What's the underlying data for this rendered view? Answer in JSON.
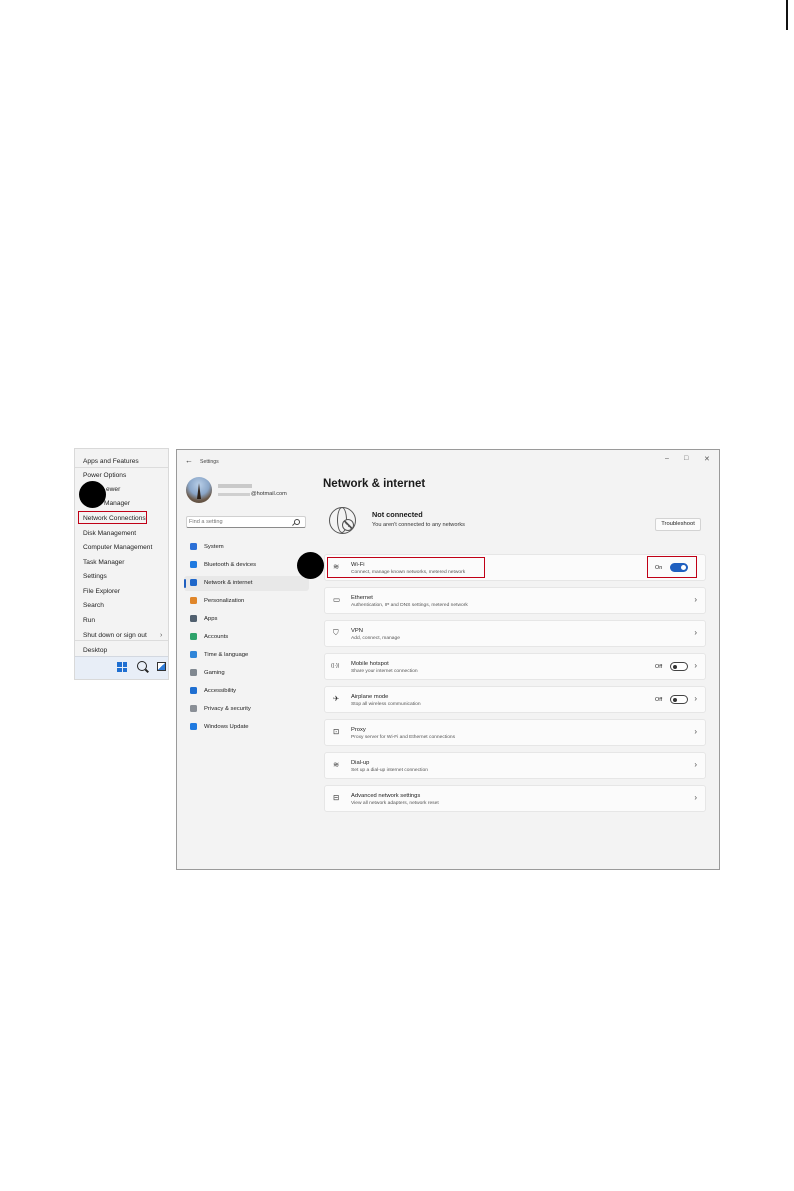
{
  "winx_menu": {
    "items": [
      {
        "label": "Apps and Features"
      },
      {
        "label": "Power Options"
      },
      {
        "label": "ewer"
      },
      {
        "label": "Manager"
      },
      {
        "label": "Network Connections"
      },
      {
        "label": "Disk Management"
      },
      {
        "label": "Computer Management"
      },
      {
        "label": "Task Manager"
      },
      {
        "label": "Settings"
      },
      {
        "label": "File Explorer"
      },
      {
        "label": "Search"
      },
      {
        "label": "Run"
      },
      {
        "label": "Shut down or sign out",
        "submenu": "›"
      },
      {
        "label": "Desktop"
      }
    ]
  },
  "settings": {
    "window_title": "Settings",
    "controls": {
      "minimize": "–",
      "maximize": "□",
      "close": "✕"
    },
    "back_glyph": "←",
    "profile": {
      "email": "@hotmail.com"
    },
    "search": {
      "placeholder": "Find a setting"
    },
    "nav": [
      {
        "label": "System",
        "icon": "system-icon",
        "color": "#2b6fd6"
      },
      {
        "label": "Bluetooth & devices",
        "icon": "bluetooth-icon",
        "color": "#1f7ae0"
      },
      {
        "label": "Network & internet",
        "icon": "wifi-icon",
        "color": "#1e66c9",
        "selected": true
      },
      {
        "label": "Personalization",
        "icon": "brush-icon",
        "color": "#e0862a"
      },
      {
        "label": "Apps",
        "icon": "apps-icon",
        "color": "#51606f"
      },
      {
        "label": "Accounts",
        "icon": "person-icon",
        "color": "#2ea36b"
      },
      {
        "label": "Time & language",
        "icon": "globe-clock-icon",
        "color": "#2f85d8"
      },
      {
        "label": "Gaming",
        "icon": "gamepad-icon",
        "color": "#808890"
      },
      {
        "label": "Accessibility",
        "icon": "accessibility-icon",
        "color": "#1f6fd1"
      },
      {
        "label": "Privacy & security",
        "icon": "shield-icon",
        "color": "#8a8f96"
      },
      {
        "label": "Windows Update",
        "icon": "update-icon",
        "color": "#1f7ae0"
      }
    ],
    "page_title": "Network & internet",
    "status": {
      "title": "Not connected",
      "subtitle": "You aren't connected to any networks",
      "button": "Troubleshoot"
    },
    "cards": [
      {
        "title": "Wi-Fi",
        "desc": "Connect, manage known networks, metered network",
        "icon": "wifi-icon",
        "glyph": "≋",
        "toggle": "On",
        "toggle_on": true
      },
      {
        "title": "Ethernet",
        "desc": "Authentication, IP and DNS settings, metered network",
        "icon": "ethernet-icon",
        "glyph": "▭",
        "chevron": "›"
      },
      {
        "title": "VPN",
        "desc": "Add, connect, manage",
        "icon": "vpn-shield-icon",
        "glyph": "⛉",
        "chevron": "›"
      },
      {
        "title": "Mobile hotspot",
        "desc": "Share your internet connection",
        "icon": "hotspot-icon",
        "glyph": "((·))",
        "toggle": "Off",
        "toggle_on": false,
        "chevron": "›"
      },
      {
        "title": "Airplane mode",
        "desc": "Stop all wireless communication",
        "icon": "airplane-icon",
        "glyph": "✈",
        "toggle": "Off",
        "toggle_on": false,
        "chevron": "›"
      },
      {
        "title": "Proxy",
        "desc": "Proxy server for Wi-Fi and Ethernet connections",
        "icon": "proxy-icon",
        "glyph": "⊡",
        "chevron": "›"
      },
      {
        "title": "Dial-up",
        "desc": "Set up a dial-up internet connection",
        "icon": "dialup-icon",
        "glyph": "≋",
        "chevron": "›"
      },
      {
        "title": "Advanced network settings",
        "desc": "View all network adapters, network reset",
        "icon": "monitor-network-icon",
        "glyph": "⊟",
        "chevron": "›"
      }
    ]
  }
}
